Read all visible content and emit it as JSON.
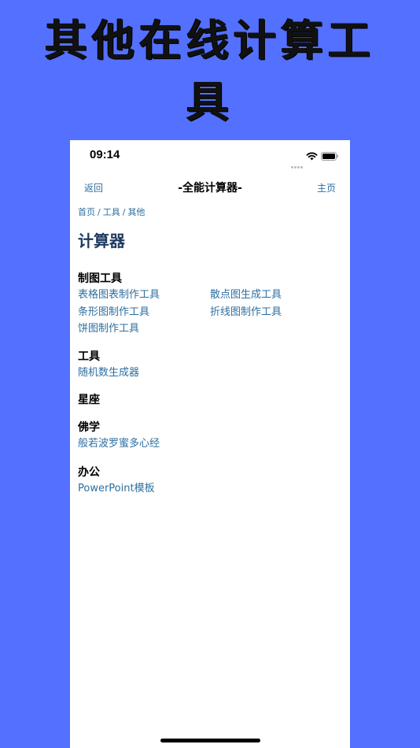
{
  "headline": {
    "line1": "其他在线计算工",
    "line2": "具"
  },
  "status_bar": {
    "time": "09:14",
    "icons": [
      "signal-dots-icon",
      "wifi-icon",
      "battery-icon"
    ]
  },
  "nav": {
    "back": "返回",
    "title": "-全能计算器-",
    "home": "主页"
  },
  "breadcrumb": [
    "首页",
    "工具",
    "其他"
  ],
  "page_title": "计算器",
  "sections": [
    {
      "title": "制图工具",
      "links": [
        "表格图表制作工具",
        "散点图生成工具",
        "条形图制作工具",
        "折线图制作工具",
        "饼图制作工具"
      ]
    },
    {
      "title": "工具",
      "links": [
        "随机数生成器"
      ]
    },
    {
      "title": "星座",
      "links": []
    },
    {
      "title": "佛学",
      "links": [
        "般若波罗蜜多心经"
      ]
    },
    {
      "title": "办公",
      "links": [
        "PowerPoint模板"
      ]
    }
  ],
  "colors": {
    "background": "#5470ff",
    "link": "#2e6fa0",
    "title": "#1e3a5f"
  }
}
